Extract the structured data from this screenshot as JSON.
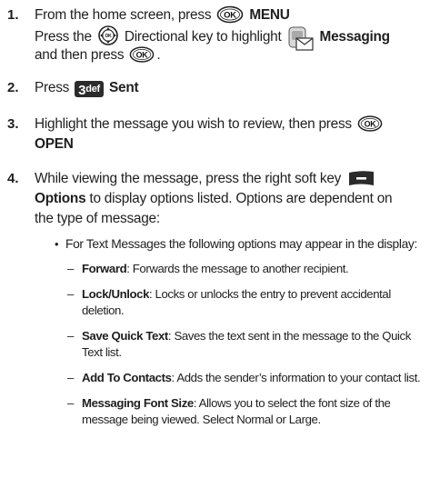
{
  "steps": [
    {
      "number": "1.",
      "parts": {
        "a": "From the home screen, press",
        "menu": "MENU",
        "b_pre": "Press the",
        "b_mid": "Directional key to highlight",
        "messaging": "Messaging",
        "c_pre": "and then press",
        "c_post": "."
      }
    },
    {
      "number": "2.",
      "parts": {
        "a": "Press",
        "sent": "Sent",
        "key_label": "def",
        "key_digit": "3"
      }
    },
    {
      "number": "3.",
      "parts": {
        "a": "Highlight the message you wish to review, then press",
        "open": "OPEN"
      }
    },
    {
      "number": "4.",
      "parts": {
        "a": "While viewing the message, press the right soft key",
        "options": "Options",
        "b": "to display options listed. Options are dependent on",
        "c": "the type of message:"
      }
    }
  ],
  "bullet": {
    "dot": "•",
    "text": "For Text Messages the following options may appear in the display:"
  },
  "options": [
    {
      "term": "Forward",
      "desc": ": Forwards the message to another recipient.",
      "desc2": ""
    },
    {
      "term": "Lock/Unlock",
      "desc": ": Locks or unlocks the entry to prevent accidental",
      "desc2": "deletion."
    },
    {
      "term": "Save Quick Text",
      "desc": ": Saves the text sent in the message to the Quick",
      "desc2": "Text list."
    },
    {
      "term": "Add To Contacts",
      "desc": ": Adds the sender’s information to your contact list.",
      "desc2": ""
    },
    {
      "term": "Messaging Font Size",
      "desc": ": Allows you to select the font size of the",
      "desc2": "message being viewed. Select Normal or Large."
    }
  ],
  "dash": "–",
  "icons": {
    "ok_key": "ok-key-icon",
    "directional_key": "directional-key-icon",
    "messaging_app": "messaging-envelope-icon",
    "key_3def": "key-3def-icon",
    "right_soft_key": "right-soft-key-icon"
  },
  "colors": {
    "text": "#1f1f1f",
    "key_fill": "#2b2b2b",
    "key_text": "#ffffff"
  }
}
